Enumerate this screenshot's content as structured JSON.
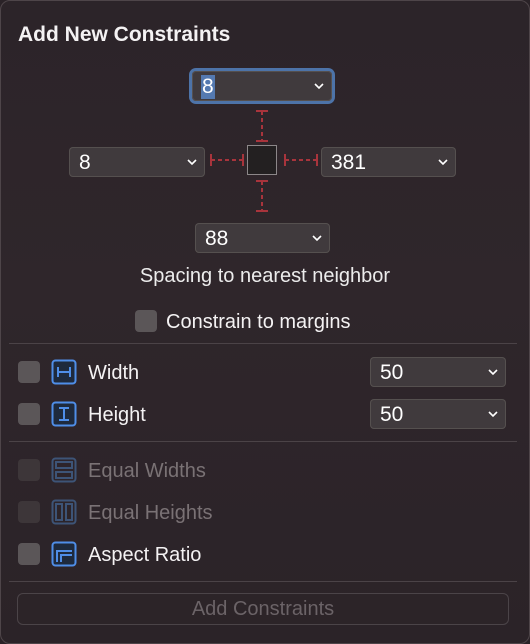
{
  "title": "Add New Constraints",
  "spacing": {
    "top": "8",
    "left": "8",
    "right": "381",
    "bottom": "88",
    "caption": "Spacing to nearest neighbor"
  },
  "constrain_margins": {
    "label": "Constrain to margins",
    "checked": false
  },
  "width": {
    "label": "Width",
    "value": "50",
    "checked": false
  },
  "height": {
    "label": "Height",
    "value": "50",
    "checked": false
  },
  "equal_widths": {
    "label": "Equal Widths",
    "enabled": false
  },
  "equal_heights": {
    "label": "Equal Heights",
    "enabled": false
  },
  "aspect_ratio": {
    "label": "Aspect Ratio",
    "checked": false
  },
  "add_button": {
    "label": "Add Constraints",
    "enabled": false
  },
  "colors": {
    "accent": "#4d73a8",
    "strut": "#a8343c",
    "icon_blue": "#4f8ee8"
  }
}
